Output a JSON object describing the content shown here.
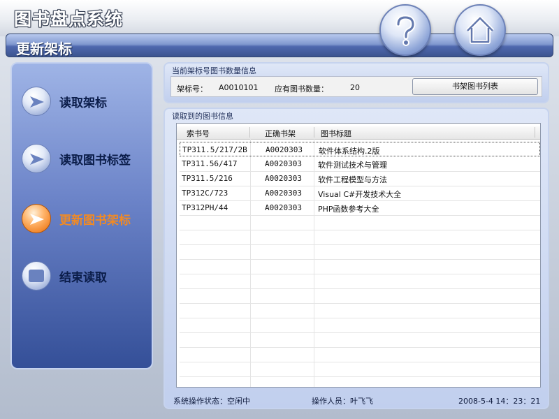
{
  "app": {
    "title": "图书盘点系统",
    "subtitle": "更新架标"
  },
  "header_buttons": [
    {
      "name": "help",
      "icon": "question-icon"
    },
    {
      "name": "home",
      "icon": "home-icon"
    }
  ],
  "nav": {
    "items": [
      {
        "label": "读取架标",
        "icon": "arrow-right-icon",
        "active": false
      },
      {
        "label": "读取图书标签",
        "icon": "arrow-right-icon",
        "active": false
      },
      {
        "label": "更新图书架标",
        "icon": "arrow-right-icon",
        "active": true
      },
      {
        "label": "结束读取",
        "icon": "stop-icon",
        "active": false
      }
    ]
  },
  "shelf_info": {
    "heading": "当前架标号图书数量信息",
    "shelf_label": "架标号：",
    "shelf_value": "A0010101",
    "count_label": "应有图书数量：",
    "count_value": "20",
    "list_button": "书架图书列表"
  },
  "books": {
    "heading": "读取到的图书信息",
    "columns": [
      "索书号",
      "正确书架",
      "图书标题"
    ],
    "rows": [
      [
        "TP311.5/217/2B",
        "A0020303",
        "软件体系结构.2版"
      ],
      [
        "TP311.56/417",
        "A0020303",
        "软件测试技术与管理"
      ],
      [
        "TP311.5/216",
        "A0020303",
        "软件工程模型与方法"
      ],
      [
        "TP312C/723",
        "A0020303",
        "Visual C#开发技术大全"
      ],
      [
        "TP312PH/44",
        "A0020303",
        "PHP函数参考大全"
      ]
    ]
  },
  "status": {
    "state": "系统操作状态：空闲中",
    "operator": "操作人员：叶飞飞",
    "datetime": "2008-5-4 14：23：21"
  },
  "colors": {
    "active_nav": "#f08a25",
    "accent_blue": "#344f98"
  }
}
